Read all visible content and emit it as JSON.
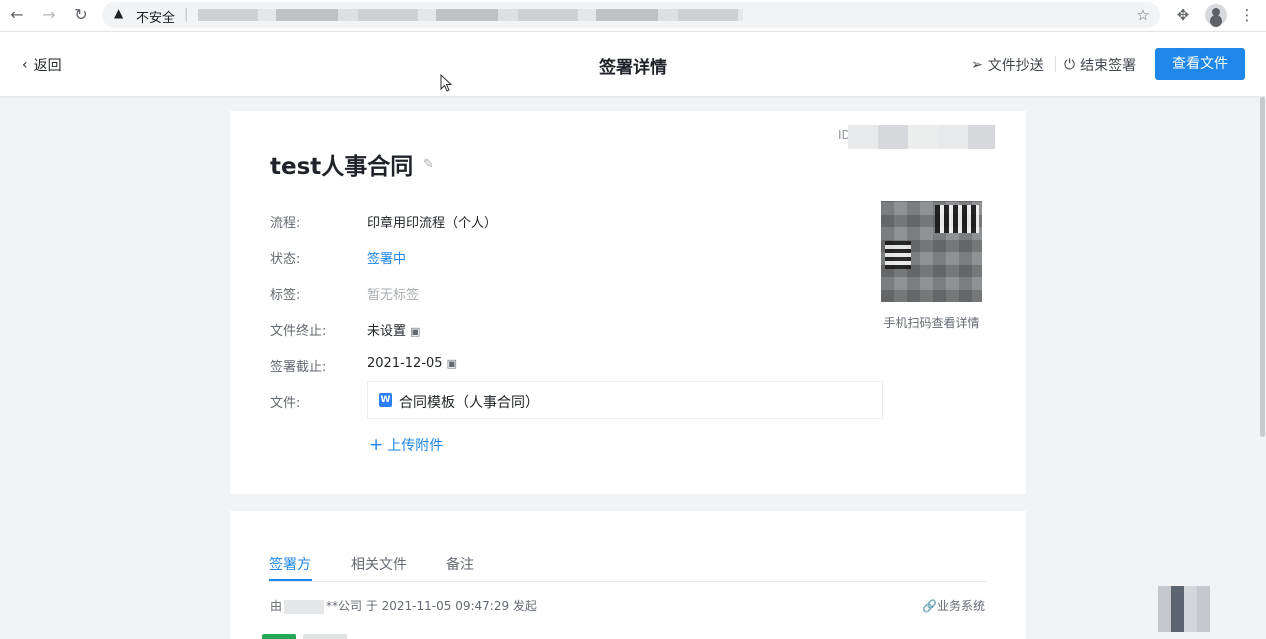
{
  "browser": {
    "insecure_label": "不安全",
    "icons": {
      "back": "arrow-left-icon",
      "forward": "arrow-right-icon",
      "reload": "reload-icon",
      "warning": "warning-icon",
      "bookmark": "star-icon",
      "extensions": "puzzle-icon",
      "profile": "profile-icon",
      "menu": "kebab-menu-icon"
    }
  },
  "header": {
    "back_label": "返回",
    "title": "签署详情",
    "copy_file_label": "文件抄送",
    "end_sign_label": "结束签署",
    "view_file_label": "查看文件"
  },
  "detail": {
    "id_label": "ID",
    "doc_title": "test人事合同",
    "fields": [
      {
        "label": "流程:",
        "value": "印章用印流程（个人）"
      },
      {
        "label": "状态:",
        "value": "签署中"
      },
      {
        "label": "标签:",
        "value": "暂无标签"
      },
      {
        "label": "文件终止:",
        "value": "未设置"
      },
      {
        "label": "签署截止:",
        "value": "2021-12-05"
      },
      {
        "label": "文件:",
        "value": "合同模板（人事合同）"
      }
    ],
    "upload_label": "上传附件",
    "qr_caption": "手机扫码查看详情"
  },
  "sign": {
    "tabs": [
      "签署方",
      "相关文件",
      "备注"
    ],
    "origin_prefix": "由",
    "origin_suffix": "**公司 于 2021-11-05 09:47:29 发起",
    "biz_system_label": "业务系统"
  },
  "colors": {
    "primary": "#1f87ea",
    "status_signing": "#1f87ea",
    "badge_green": "#23a855"
  }
}
